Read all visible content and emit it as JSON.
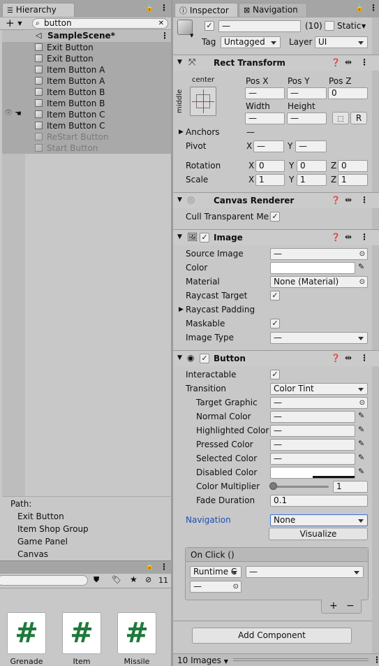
{
  "hierarchy": {
    "tab_label": "Hierarchy",
    "search_value": "button",
    "scene_name": "SampleScene*",
    "items": [
      {
        "label": "Exit Button",
        "dim": false
      },
      {
        "label": "Exit Button",
        "dim": false
      },
      {
        "label": "Item Button A",
        "dim": false
      },
      {
        "label": "Item Button A",
        "dim": false
      },
      {
        "label": "Item Button B",
        "dim": false
      },
      {
        "label": "Item Button B",
        "dim": false
      },
      {
        "label": "Item Button C",
        "dim": false
      },
      {
        "label": "Item Button C",
        "dim": false
      },
      {
        "label": "ReStart Button",
        "dim": true
      },
      {
        "label": "Start Button",
        "dim": true
      }
    ],
    "path_label": "Path:",
    "path": [
      "Exit Button",
      "Item Shop Group",
      "Game Panel",
      "Canvas"
    ]
  },
  "project": {
    "hidden_count": "11",
    "assets": [
      "Grenade",
      "Item",
      "Missile"
    ],
    "asset_glyph": "#"
  },
  "inspector": {
    "tab_label": "Inspector",
    "nav_tab_label": "Navigation",
    "name_value": "—",
    "multi_count": "(10)",
    "static_label": "Static",
    "tag_label": "Tag",
    "tag_value": "Untagged",
    "layer_label": "Layer",
    "layer_value": "UI",
    "rect_transform": {
      "title": "Rect Transform",
      "anchor_top": "center",
      "anchor_side": "middle",
      "pos_x_label": "Pos X",
      "pos_y_label": "Pos Y",
      "pos_z_label": "Pos Z",
      "pos_x": "—",
      "pos_y": "—",
      "pos_z": "0",
      "width_label": "Width",
      "height_label": "Height",
      "width": "—",
      "height": "—",
      "r_button": "R",
      "anchors_label": "Anchors",
      "anchors_value": "—",
      "pivot_label": "Pivot",
      "pivot_x": "—",
      "pivot_y": "—",
      "rotation_label": "Rotation",
      "rot_x": "0",
      "rot_y": "0",
      "rot_z": "0",
      "scale_label": "Scale",
      "scale_x": "1",
      "scale_y": "1",
      "scale_z": "1",
      "x": "X",
      "y": "Y",
      "z": "Z"
    },
    "canvas_renderer": {
      "title": "Canvas Renderer",
      "cull_label": "Cull Transparent Mes"
    },
    "image": {
      "title": "Image",
      "source_label": "Source Image",
      "source_value": "—",
      "color_label": "Color",
      "material_label": "Material",
      "material_value": "None (Material)",
      "raycast_label": "Raycast Target",
      "padding_label": "Raycast Padding",
      "maskable_label": "Maskable",
      "type_label": "Image Type",
      "type_value": "—"
    },
    "button": {
      "title": "Button",
      "interactable_label": "Interactable",
      "transition_label": "Transition",
      "transition_value": "Color Tint",
      "target_label": "Target Graphic",
      "target_value": "—",
      "normal_label": "Normal Color",
      "normal_value": "—",
      "highlighted_label": "Highlighted Color",
      "highlighted_value": "—",
      "pressed_label": "Pressed Color",
      "pressed_value": "—",
      "selected_label": "Selected Color",
      "selected_value": "—",
      "disabled_label": "Disabled Color",
      "multiplier_label": "Color Multiplier",
      "multiplier_value": "1",
      "fade_label": "Fade Duration",
      "fade_value": "0.1",
      "navigation_label": "Navigation",
      "navigation_value": "None",
      "visualize_label": "Visualize",
      "onclick_label": "On Click ()",
      "runtime_value": "Runtime C",
      "function_value": "—",
      "object_value": "—",
      "plus": "+",
      "minus": "−"
    },
    "add_component_label": "Add Component",
    "preview_label": "10 Images"
  },
  "colors": {
    "selected_row": "#a3a3a3",
    "navigation_link": "#1f4fb3",
    "accent_blue": "#3a72d8",
    "asset_green": "#1d7a3a"
  }
}
